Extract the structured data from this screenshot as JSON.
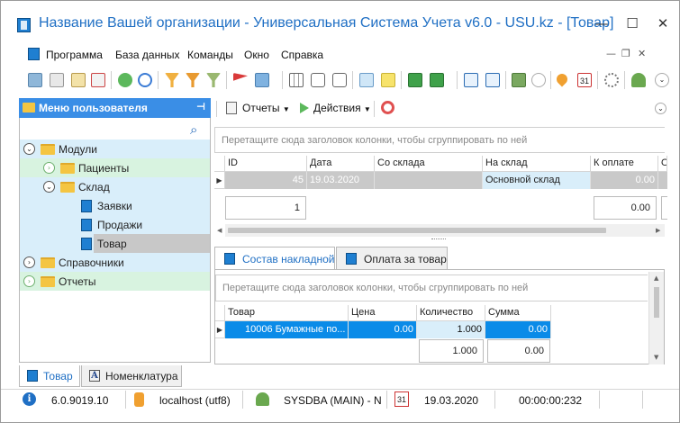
{
  "window": {
    "title": "Название Вашей организации - Универсальная Система Учета v6.0 - USU.kz - [Товар]",
    "controls": {
      "minimize": "—",
      "maximize": "☐",
      "close": "✕"
    }
  },
  "menu": {
    "items": [
      "Программа",
      "База данных",
      "Команды",
      "Окно",
      "Справка"
    ],
    "mdi_controls": {
      "minimize": "—",
      "restore": "❐",
      "close": "✕"
    }
  },
  "toolbar": {
    "icons": [
      "refresh-doc-icon",
      "copy-icon",
      "edit-icon",
      "delete-icon",
      "reload-icon",
      "zoom-icon",
      "filter-icon",
      "filter-clear-icon",
      "filter-settings-icon",
      "flag-icon",
      "image-icon",
      "columns-icon",
      "collapse-icon",
      "expand-icon",
      "add-row-icon",
      "note-icon",
      "export-excel-icon",
      "delete-excel-icon",
      "new-window-icon",
      "close-window-icon",
      "exit-icon",
      "circle-arrow-icon",
      "pin-icon",
      "calendar-icon",
      "settings-icon",
      "users-icon",
      "chevron-double-down-icon"
    ],
    "calendar_day": "31"
  },
  "left_panel": {
    "title": "Меню пользователя",
    "tree": [
      {
        "label": "Модули",
        "level": 0,
        "expanded": true
      },
      {
        "label": "Пациенты",
        "level": 1,
        "expanded": false
      },
      {
        "label": "Склад",
        "level": 1,
        "expanded": true
      },
      {
        "label": "Заявки",
        "level": 2
      },
      {
        "label": "Продажи",
        "level": 2
      },
      {
        "label": "Товар",
        "level": 2,
        "selected": true
      },
      {
        "label": "Справочники",
        "level": 0,
        "expanded": false
      },
      {
        "label": "Отчеты",
        "level": 0,
        "expanded": false
      }
    ]
  },
  "right_toolbar": {
    "reports": "Отчеты",
    "actions": "Действия"
  },
  "main_grid": {
    "group_hint": "Перетащите сюда заголовок колонки, чтобы сгруппировать по ней",
    "columns": [
      "ID",
      "Дата",
      "Со склада",
      "На склад",
      "К оплате",
      "О"
    ],
    "rows": [
      {
        "id": "45",
        "date": "19.03.2020",
        "from": "",
        "to": "Основной склад",
        "to_pay": "0.00"
      }
    ],
    "summary": {
      "count": "1",
      "to_pay": "0.00"
    }
  },
  "detail_tabs": [
    "Состав накладной",
    "Оплата за товар"
  ],
  "detail_grid": {
    "group_hint": "Перетащите сюда заголовок колонки, чтобы сгруппировать по ней",
    "columns": [
      "Товар",
      "Цена",
      "Количество",
      "Сумма"
    ],
    "rows": [
      {
        "product": "10006 Бумажные по...",
        "price": "0.00",
        "qty": "1.000",
        "sum": "0.00"
      }
    ],
    "summary": {
      "qty": "1.000",
      "sum": "0.00"
    }
  },
  "bottom_tabs": [
    "Товар",
    "Номенклатура"
  ],
  "status": {
    "version": "6.0.9019.10",
    "db": "localhost (utf8)",
    "user": "SYSDBA (MAIN) - N",
    "date": "19.03.2020",
    "timer": "00:00:00:232",
    "calendar_day": "31"
  },
  "colors": {
    "accent": "#3a8ee6",
    "title": "#1f6fc4",
    "selected_row": "#0a8be8",
    "tree_green": "#d8f3e0",
    "tree_blue": "#d9eefa"
  }
}
